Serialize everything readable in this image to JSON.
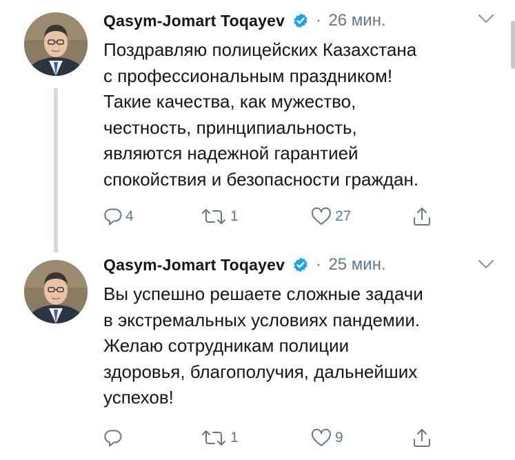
{
  "tweets": [
    {
      "author": "Qasym-Jomart Toqayev",
      "separator": "·",
      "time": "26 мин.",
      "lines": [
        "Поздравляю полицейских Казахстана",
        "с профессиональным праздником!",
        "Такие качества, как мужество,",
        "честность, принципиальность,",
        "являются надежной гарантией",
        "спокойствия и безопасности граждан."
      ],
      "replies": "4",
      "retweets": "1",
      "likes": "27"
    },
    {
      "author": "Qasym-Jomart Toqayev",
      "separator": "·",
      "time": "25 мин.",
      "lines": [
        "Вы успешно решаете сложные задачи",
        "в экстремальных условиях пандемии.",
        "Желаю сотрудникам полиции",
        "здоровья, благополучия, дальнейших",
        "успехов!"
      ],
      "replies": "",
      "retweets": "1",
      "likes": "9"
    }
  ],
  "icons": {
    "verified": "verified-badge-icon",
    "reply": "reply-icon",
    "retweet": "retweet-icon",
    "like": "heart-icon",
    "share": "share-icon",
    "menu": "chevron-down-icon"
  },
  "colors": {
    "verified": "#1da1f2",
    "muted": "#657786",
    "text": "#14171a",
    "thread_line": "#cfd9de"
  }
}
